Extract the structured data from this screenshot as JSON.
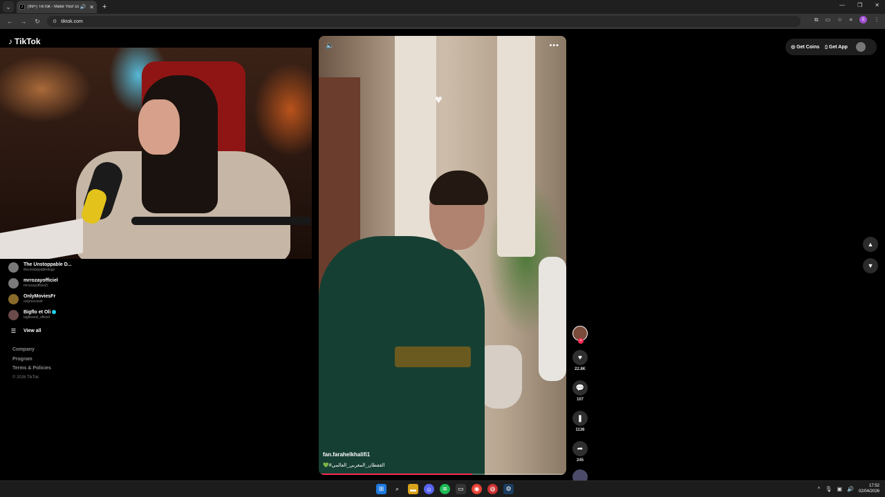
{
  "browser": {
    "tab_title": "(99+) TikTok - Make Your Day",
    "url": "tiktok.com",
    "profile_initial": "S"
  },
  "tiktok": {
    "logo_text": "TikTok",
    "following": [
      {
        "name": "The Unstoppable D...",
        "handle": "theunstoppabledogs"
      },
      {
        "name": "mrrozayofficiel",
        "handle": "mrrozayofficiel3"
      },
      {
        "name": "OnlyMoviesFr",
        "handle": "onlymoviesfr"
      },
      {
        "name": "Bigflo et Oli",
        "handle": "bigfloetoli_officiel"
      }
    ],
    "view_all": "View all",
    "footer": {
      "company": "Company",
      "program": "Program",
      "terms": "Terms & Policies",
      "copyright": "© 2026 TikTok"
    },
    "top_right": {
      "get_coins": "Get Coins",
      "get_app": "Get App"
    },
    "video": {
      "author": "fan.farahelkhalifi1",
      "caption": "💚#القفطان_المغربي_العالمي",
      "progress": 0.62
    },
    "actions": {
      "likes": "22.8K",
      "comments": "107",
      "saves": "1136",
      "shares": "245"
    }
  },
  "taskbar": {
    "time": "17:52",
    "date": "02/04/2026"
  },
  "colors": {
    "accent": "#fe2c55",
    "bg": "#000000"
  }
}
